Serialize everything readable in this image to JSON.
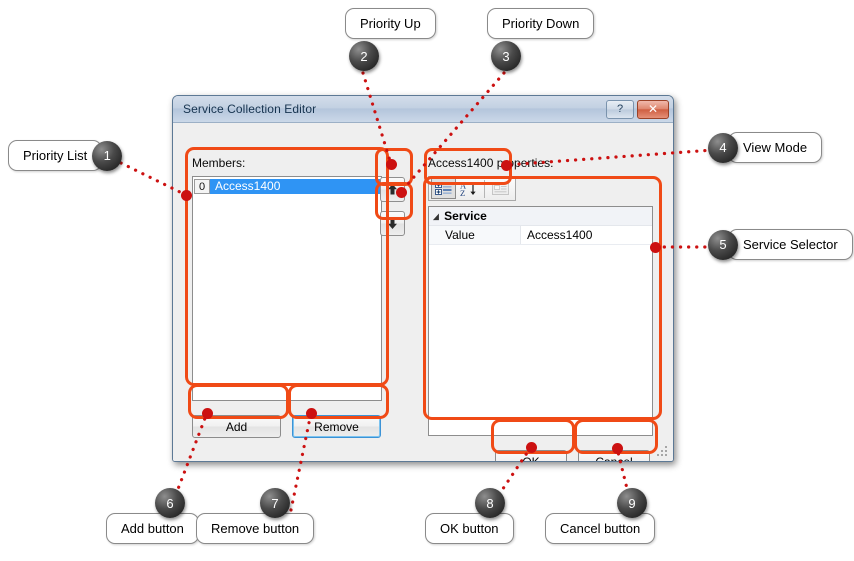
{
  "dialog": {
    "title": "Service Collection Editor",
    "help_button": "?",
    "close_button": "✕",
    "members_label": "Members:",
    "properties_label": "Access1400 properties:",
    "members": [
      {
        "index": "0",
        "name": "Access1400",
        "selected": true
      }
    ],
    "move_up_icon": "⬆",
    "move_down_icon": "⬇",
    "toolbar": {
      "categorized_icon": "categorized-view-icon",
      "alphabetical_icon": "alphabetical-sort-icon",
      "property_pages_icon": "property-pages-icon"
    },
    "property_grid": {
      "expander": "◢",
      "category": "Service",
      "rows": [
        {
          "name": "Value",
          "value": "Access1400"
        }
      ]
    },
    "buttons": {
      "add": "Add",
      "remove": "Remove",
      "ok": "OK",
      "cancel": "Cancel"
    }
  },
  "annotations": [
    {
      "number": "1",
      "label": "Priority List"
    },
    {
      "number": "2",
      "label": "Priority Up"
    },
    {
      "number": "3",
      "label": "Priority Down"
    },
    {
      "number": "4",
      "label": "View Mode"
    },
    {
      "number": "5",
      "label": "Service Selector"
    },
    {
      "number": "6",
      "label": "Add button"
    },
    {
      "number": "7",
      "label": "Remove button"
    },
    {
      "number": "8",
      "label": "OK button"
    },
    {
      "number": "9",
      "label": "Cancel button"
    }
  ],
  "colors": {
    "highlight_ring": "#f04a16",
    "leader_line": "#cc1111",
    "selection": "#2f94f4",
    "title_text": "#16334f"
  }
}
